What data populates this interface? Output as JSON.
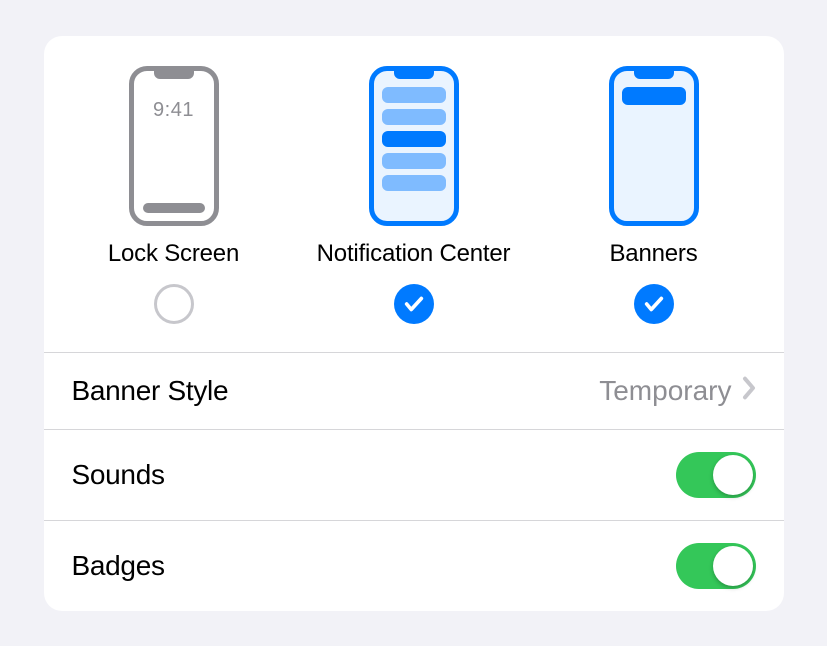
{
  "alerts": {
    "lock_screen": {
      "label": "Lock Screen",
      "time": "9:41",
      "checked": false
    },
    "notification_center": {
      "label": "Notification Center",
      "checked": true
    },
    "banners": {
      "label": "Banners",
      "checked": true
    }
  },
  "rows": {
    "banner_style": {
      "label": "Banner Style",
      "value": "Temporary"
    },
    "sounds": {
      "label": "Sounds",
      "on": true
    },
    "badges": {
      "label": "Badges",
      "on": true
    }
  },
  "colors": {
    "accent": "#007aff",
    "toggle_on": "#34c759",
    "gray": "#8e8e93"
  }
}
